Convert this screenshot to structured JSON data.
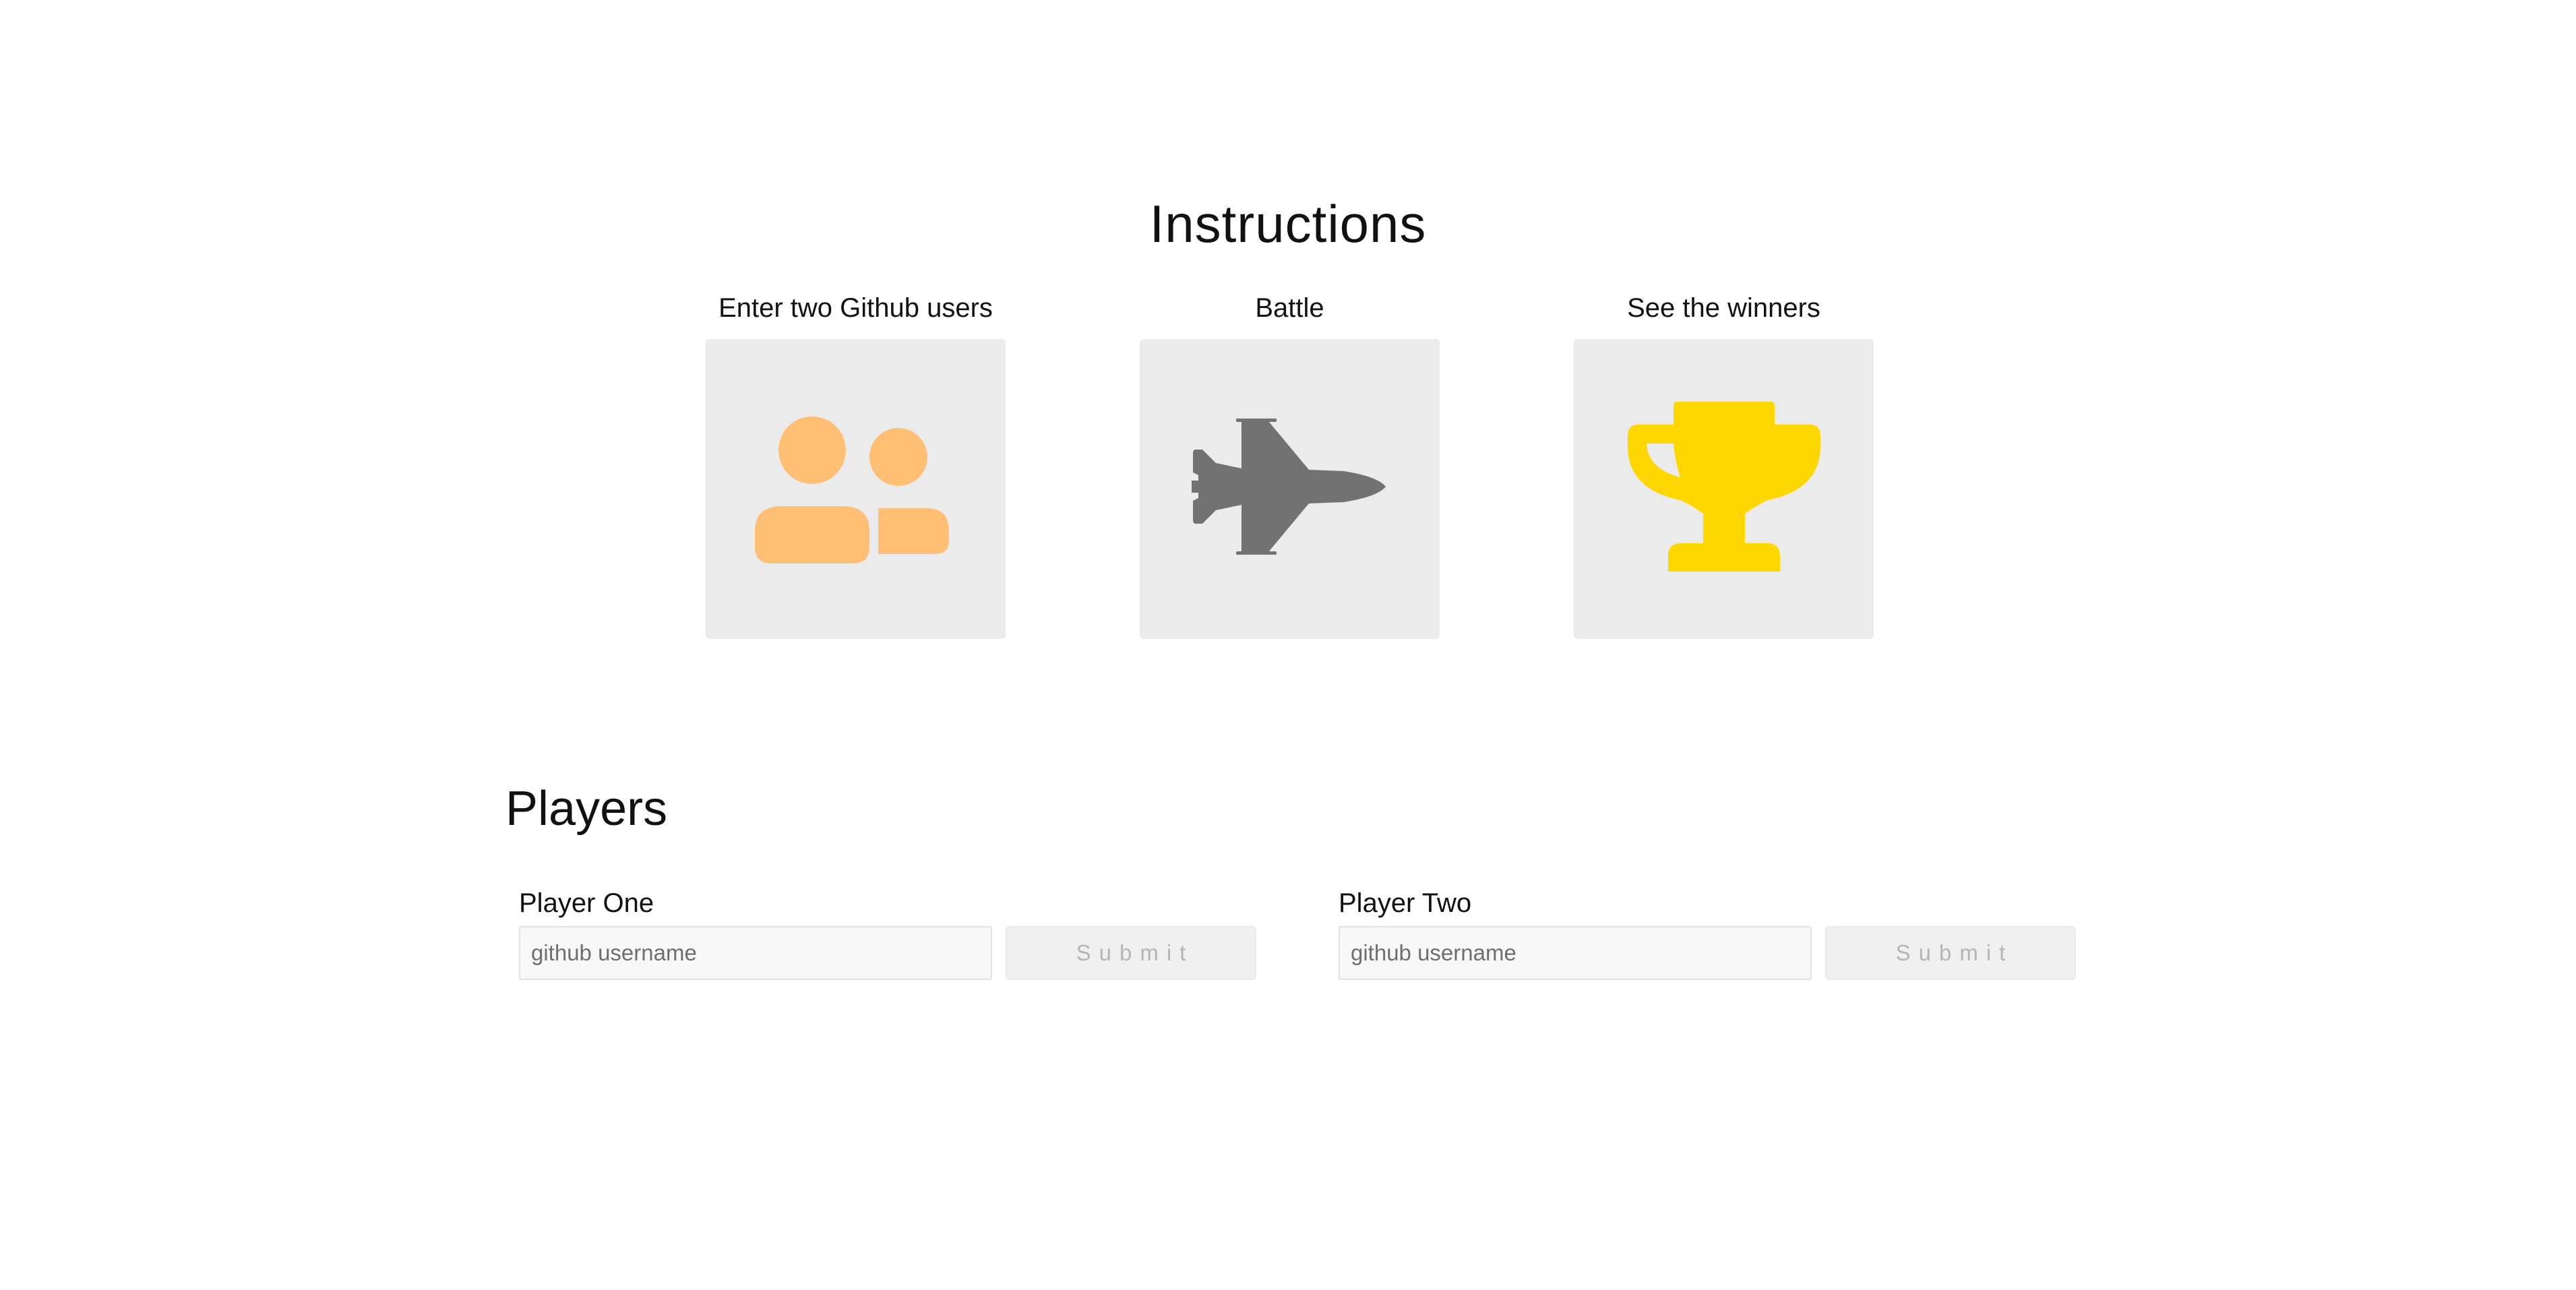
{
  "instructions": {
    "title": "Instructions",
    "steps": [
      {
        "label": "Enter two Github users",
        "icon": "users-icon",
        "icon_color": "#ffbf74"
      },
      {
        "label": "Battle",
        "icon": "fighter-jet-icon",
        "icon_color": "#727272"
      },
      {
        "label": "See the winners",
        "icon": "trophy-icon",
        "icon_color": "#ffd700"
      }
    ],
    "card_color": "#ebebeb"
  },
  "players": {
    "title": "Players",
    "player_one": {
      "label": "Player One",
      "input_value": "",
      "input_placeholder": "github username",
      "submit_label": "Submit"
    },
    "player_two": {
      "label": "Player Two",
      "input_value": "",
      "input_placeholder": "github username",
      "submit_label": "Submit"
    }
  }
}
